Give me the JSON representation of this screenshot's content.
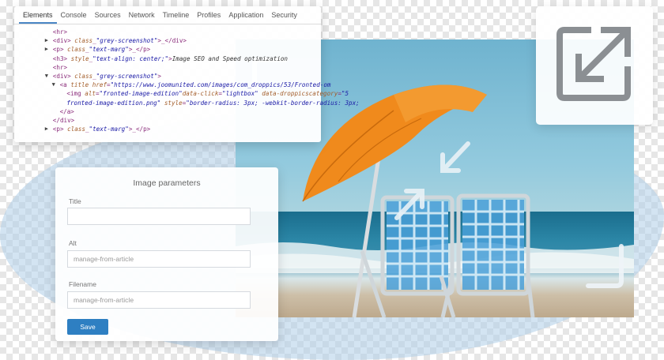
{
  "devtools": {
    "tabs": [
      "Elements",
      "Console",
      "Sources",
      "Network",
      "Timeline",
      "Profiles",
      "Application",
      "Security"
    ],
    "active_tab": "Elements",
    "lines": [
      {
        "indent": 4,
        "arrow": "",
        "parts": [
          {
            "c": "tag",
            "t": "<hr>"
          }
        ]
      },
      {
        "indent": 4,
        "arrow": "▶",
        "parts": [
          {
            "c": "tag",
            "t": "<div> "
          },
          {
            "c": "attr",
            "t": "class"
          },
          {
            "c": "tag",
            "t": "_"
          },
          {
            "c": "val",
            "t": "\"grey-screenshot\""
          },
          {
            "c": "tag",
            "t": ">_</div>"
          }
        ]
      },
      {
        "indent": 4,
        "arrow": "▶",
        "parts": [
          {
            "c": "tag",
            "t": "<p> "
          },
          {
            "c": "attr",
            "t": "class"
          },
          {
            "c": "tag",
            "t": "_"
          },
          {
            "c": "val",
            "t": "\"text-marg\""
          },
          {
            "c": "tag",
            "t": ">_</p>"
          }
        ]
      },
      {
        "indent": 4,
        "arrow": "",
        "parts": [
          {
            "c": "tag",
            "t": "<h3> "
          },
          {
            "c": "attr",
            "t": "style"
          },
          {
            "c": "tag",
            "t": "_"
          },
          {
            "c": "val",
            "t": "\"text-align: center;\""
          },
          {
            "c": "tag",
            "t": ">"
          },
          {
            "c": "txt",
            "t": "Image SEO and Speed optimization"
          }
        ]
      },
      {
        "indent": 4,
        "arrow": "",
        "parts": [
          {
            "c": "tag",
            "t": "<hr>"
          }
        ]
      },
      {
        "indent": 4,
        "arrow": "▼",
        "parts": [
          {
            "c": "tag",
            "t": "<div> "
          },
          {
            "c": "attr",
            "t": "class"
          },
          {
            "c": "tag",
            "t": "_"
          },
          {
            "c": "val",
            "t": "\"grey-screenshot\""
          },
          {
            "c": "tag",
            "t": ">"
          }
        ]
      },
      {
        "indent": 8,
        "arrow": "▼",
        "parts": [
          {
            "c": "tag",
            "t": "<a "
          },
          {
            "c": "attr",
            "t": "title href"
          },
          {
            "c": "tag",
            "t": "="
          },
          {
            "c": "val",
            "t": "\"https://www.joomunited.com/images/com_droppics/53/Fronted-om"
          }
        ]
      },
      {
        "indent": 12,
        "arrow": "",
        "parts": [
          {
            "c": "tag",
            "t": "<img "
          },
          {
            "c": "attr",
            "t": "alt"
          },
          {
            "c": "tag",
            "t": "="
          },
          {
            "c": "val",
            "t": "\"fronted-image-edition\""
          },
          {
            "c": "attr",
            "t": "data-click"
          },
          {
            "c": "tag",
            "t": "="
          },
          {
            "c": "val",
            "t": "\"lightbox\" "
          },
          {
            "c": "attr",
            "t": "data-droppicscategory"
          },
          {
            "c": "tag",
            "t": "="
          },
          {
            "c": "val",
            "t": "\"5"
          }
        ]
      },
      {
        "indent": 12,
        "arrow": "",
        "parts": [
          {
            "c": "val",
            "t": "fronted-image-edition.png\" "
          },
          {
            "c": "attr",
            "t": "style"
          },
          {
            "c": "tag",
            "t": "="
          },
          {
            "c": "val",
            "t": "\"border-radius: 3px; -webkit-border-radius: 3px;"
          }
        ]
      },
      {
        "indent": 8,
        "arrow": "",
        "parts": [
          {
            "c": "tag",
            "t": "</a>"
          }
        ]
      },
      {
        "indent": 4,
        "arrow": "",
        "parts": [
          {
            "c": "tag",
            "t": "</div>"
          }
        ]
      },
      {
        "indent": 4,
        "arrow": "▶",
        "parts": [
          {
            "c": "tag",
            "t": "<p> "
          },
          {
            "c": "attr",
            "t": "class"
          },
          {
            "c": "tag",
            "t": "_"
          },
          {
            "c": "val",
            "t": "\"text-marg\""
          },
          {
            "c": "tag",
            "t": ">_</p>"
          }
        ]
      }
    ]
  },
  "params": {
    "title": "Image parameters",
    "title_label": "Title",
    "title_value": "",
    "alt_label": "Alt",
    "alt_value": "manage-from-article",
    "filename_label": "Filename",
    "filename_value": "manage-from-article",
    "save_label": "Save"
  },
  "colors": {
    "accent": "#2e7fc2",
    "umbrella": "#f08a1c",
    "chair": "#4aa0d8"
  },
  "icons": [
    "expand-icon",
    "resize-arrows-icon"
  ]
}
